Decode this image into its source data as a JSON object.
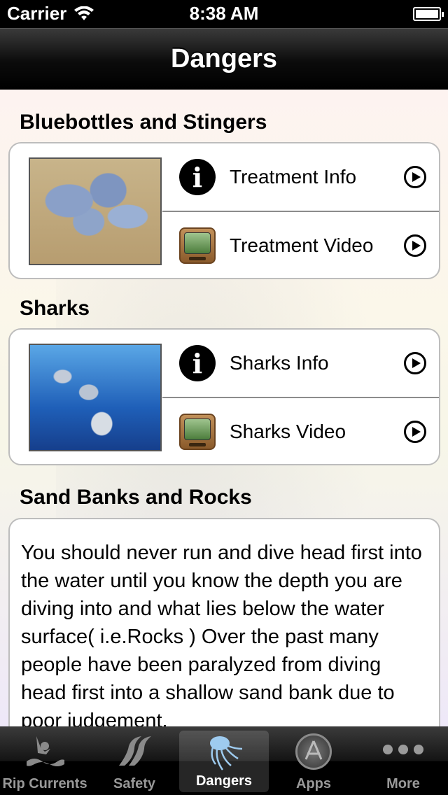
{
  "status_bar": {
    "carrier": "Carrier",
    "time": "8:38 AM"
  },
  "nav": {
    "title": "Dangers"
  },
  "sections": [
    {
      "title": "Bluebottles and Stingers",
      "rows": [
        {
          "icon": "info-icon",
          "label": "Treatment Info"
        },
        {
          "icon": "video-icon",
          "label": "Treatment Video"
        }
      ]
    },
    {
      "title": "Sharks",
      "rows": [
        {
          "icon": "info-icon",
          "label": "Sharks Info"
        },
        {
          "icon": "video-icon",
          "label": "Sharks Video"
        }
      ]
    }
  ],
  "sand_banks": {
    "title": "Sand Banks and Rocks",
    "body": "You should never run and dive head first into the water until you know the depth you are diving into and what lies below the water surface( i.e.Rocks ) Over the past many people have been paralyzed from diving head first into a shallow sand bank due to poor judgement."
  },
  "tabs": [
    {
      "label": "Rip Currents",
      "icon": "swimmer-icon",
      "active": false
    },
    {
      "label": "Safety",
      "icon": "waves-icon",
      "active": false
    },
    {
      "label": "Dangers",
      "icon": "jellyfish-icon",
      "active": true
    },
    {
      "label": "Apps",
      "icon": "app-store-icon",
      "active": false
    },
    {
      "label": "More",
      "icon": "more-icon",
      "active": false
    }
  ],
  "colors": {
    "nav_bg": "#000000",
    "tab_active_text": "#ffffff",
    "tab_inactive_text": "#999999"
  }
}
